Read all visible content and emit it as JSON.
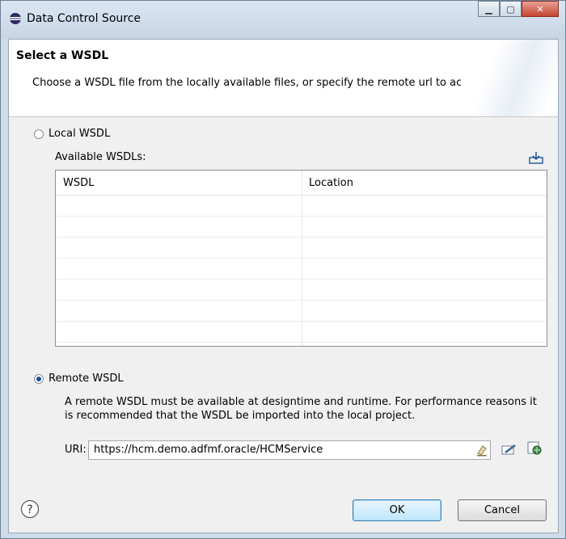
{
  "window": {
    "title": "Data Control Source"
  },
  "header": {
    "title": "Select a WSDL",
    "description": "Choose a WSDL file from the locally available files, or specify the remote url to access."
  },
  "local": {
    "radio_label": "Local WSDL",
    "selected": false,
    "available_label": "Available WSDLs:",
    "columns": [
      "WSDL",
      "Location"
    ],
    "rows": []
  },
  "remote": {
    "radio_label": "Remote WSDL",
    "selected": true,
    "note": "A remote WSDL must be available at designtime and runtime.   For performance reasons it is recommended that the WSDL be imported into the local project.",
    "uri_label": "URI:",
    "uri_value": "https://hcm.demo.adfmf.oracle/HCMService"
  },
  "footer": {
    "ok_label": "OK",
    "cancel_label": "Cancel"
  },
  "icons": {
    "help": "help-icon",
    "import": "import-icon",
    "clear": "eraser-icon",
    "edit": "edit-icon",
    "browse": "browse-icon"
  },
  "colors": {
    "accent": "#3c7fb1",
    "titlebar": "#c7d5e5",
    "close_button": "#c4452f"
  }
}
